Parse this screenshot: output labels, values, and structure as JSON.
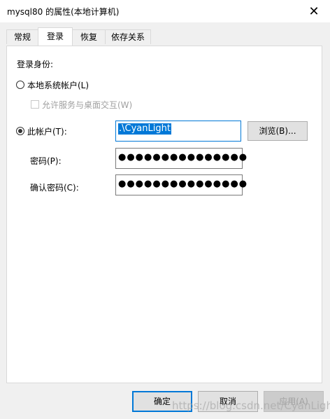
{
  "window": {
    "title": "mysql80 的属性(本地计算机)",
    "close_glyph": "✕"
  },
  "tabs": [
    {
      "label": "常规"
    },
    {
      "label": "登录"
    },
    {
      "label": "恢复"
    },
    {
      "label": "依存关系"
    }
  ],
  "active_tab": "登录",
  "logon": {
    "section_label": "登录身份:",
    "local_system_label": "本地系统帐户(L)",
    "interact_desktop_label": "允许服务与桌面交互(W)",
    "this_account_label": "此帐户(T):",
    "account_value": ".\\CyanLight",
    "browse_label": "浏览(B)...",
    "password_label": "密码(P):",
    "password_mask": "●●●●●●●●●●●●●●●",
    "confirm_label": "确认密码(C):",
    "confirm_mask": "●●●●●●●●●●●●●●●",
    "selected_option": "this_account"
  },
  "footer": {
    "ok_label": "确定",
    "cancel_label": "取消",
    "apply_label": "应用(A)",
    "watermark": "https://blog.csdn.net/CyanLight"
  },
  "colors": {
    "accent": "#0078d7",
    "panel": "#ffffff",
    "background": "#f0f0f0"
  }
}
